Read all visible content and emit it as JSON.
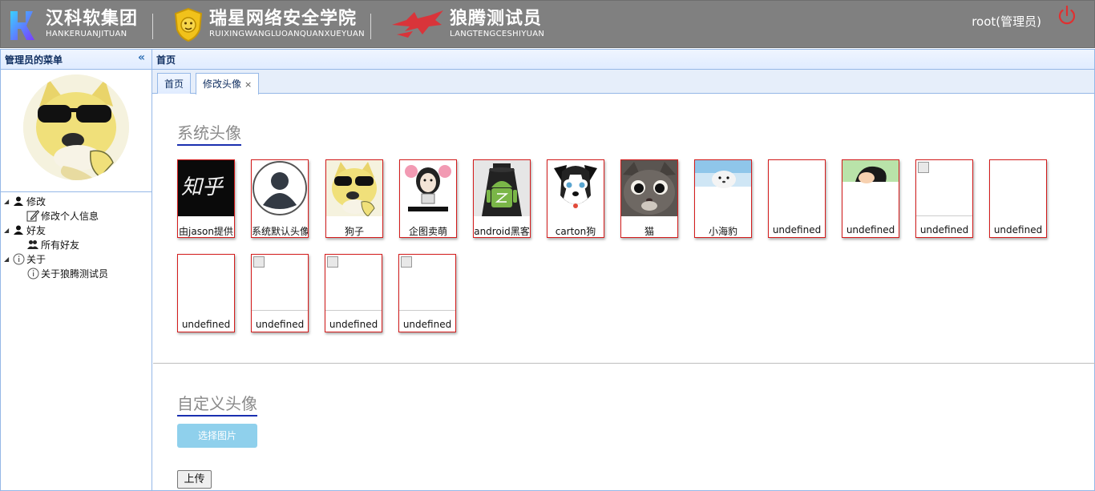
{
  "header": {
    "brands": [
      {
        "cn": "汉科软集团",
        "en": "HANKERUANJITUAN"
      },
      {
        "cn": "瑞星网络安全学院",
        "en": "RUIXINGWANGLUOANQUANXUEYUAN"
      },
      {
        "cn": "狼腾测试员",
        "en": "LANGTENGCESHIYUAN"
      }
    ],
    "user": "root(管理员)",
    "icons": {
      "logo1": "hk-logo-icon",
      "logo2": "lion-shield-icon",
      "logo3": "wolf-icon",
      "power": "power-icon"
    },
    "colors": {
      "bar": "#808080",
      "power": "#e03030"
    }
  },
  "sidebar": {
    "title": "管理员的菜单",
    "collapse": "«",
    "tree": [
      {
        "label": "修改",
        "icon": "user-icon",
        "children": [
          {
            "label": "修改个人信息",
            "icon": "edit-icon"
          }
        ]
      },
      {
        "label": "好友",
        "icon": "user-icon",
        "children": [
          {
            "label": "所有好友",
            "icon": "group-icon"
          }
        ]
      },
      {
        "label": "关于",
        "icon": "info-icon",
        "children": [
          {
            "label": "关于狼腾测试员",
            "icon": "info-icon"
          }
        ]
      }
    ]
  },
  "main": {
    "title": "首页",
    "tabs": [
      {
        "label": "首页"
      },
      {
        "label": "修改头像",
        "close": "×"
      }
    ],
    "system_title": "系统头像",
    "custom_title": "自定义头像",
    "choose_button": "选择图片",
    "upload_button": "上传",
    "avatars": [
      {
        "label": "由jason提供",
        "img": "calligraphy"
      },
      {
        "label": "系统默认头像",
        "img": "default"
      },
      {
        "label": "狗子",
        "img": "doge"
      },
      {
        "label": "企图卖萌",
        "img": "meme"
      },
      {
        "label": "android黑客",
        "img": "android"
      },
      {
        "label": "carton狗",
        "img": "cartoondog"
      },
      {
        "label": "猫",
        "img": "cat"
      },
      {
        "label": "小海豹",
        "img": "seal"
      },
      {
        "label": "undefined",
        "img": "blank"
      },
      {
        "label": "undefined",
        "img": "comic"
      },
      {
        "label": "undefined",
        "img": "broken"
      },
      {
        "label": "undefined",
        "img": "blank"
      },
      {
        "label": "undefined",
        "img": "blank"
      },
      {
        "label": "undefined",
        "img": "broken"
      },
      {
        "label": "undefined",
        "img": "broken"
      },
      {
        "label": "undefined",
        "img": "broken"
      }
    ],
    "calligraphy_text": "知乎"
  }
}
